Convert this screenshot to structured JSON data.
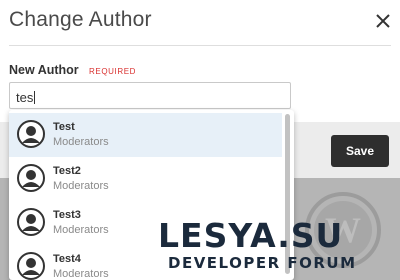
{
  "dialog": {
    "title": "Change Author",
    "close_icon": "close-icon"
  },
  "field": {
    "label": "New Author",
    "required_label": "REQUIRED",
    "value": "tes"
  },
  "results": [
    {
      "name": "Test",
      "role": "Moderators",
      "highlighted": true
    },
    {
      "name": "Test2",
      "role": "Moderators",
      "highlighted": false
    },
    {
      "name": "Test3",
      "role": "Moderators",
      "highlighted": false
    },
    {
      "name": "Test4",
      "role": "Moderators",
      "highlighted": false
    }
  ],
  "footer": {
    "save_label": "Save"
  },
  "watermark": {
    "title": "LESYA.SU",
    "subtitle": "DEVELOPER FORUM"
  },
  "colors": {
    "required": "#d9302f",
    "save_button": "#2e2e2e",
    "highlight_row": "#e7f0f8"
  }
}
